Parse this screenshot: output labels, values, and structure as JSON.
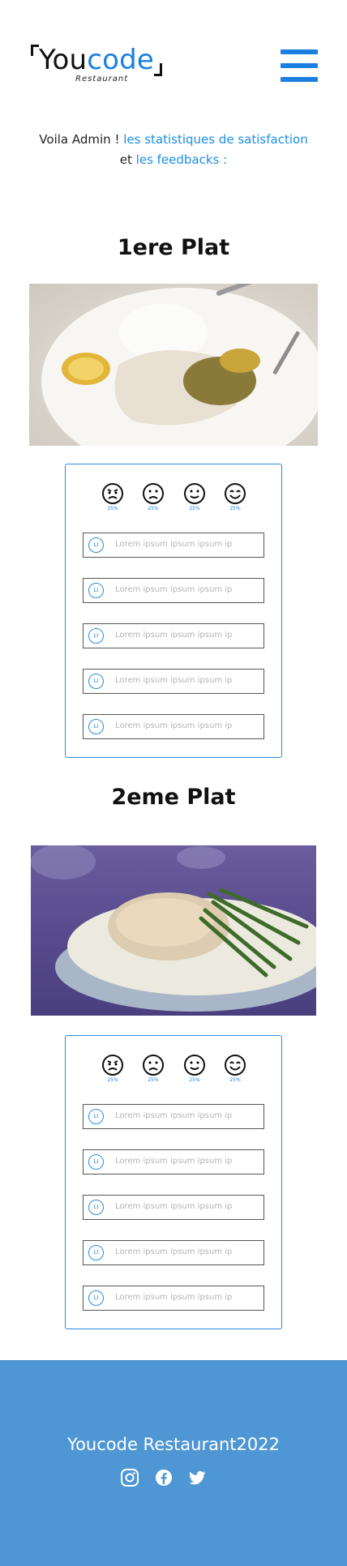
{
  "header": {
    "logo_you": "You",
    "logo_code": "code",
    "logo_sub": "Restaurant"
  },
  "intro": {
    "prefix": "Voila Admin ! ",
    "link1": "les statistiques de satisfaction",
    "middle": "et ",
    "link2": "les feedbacks :"
  },
  "dishes": [
    {
      "title": "1ere Plat",
      "ratings": [
        "25%",
        "25%",
        "25%",
        "25%"
      ],
      "feedbacks": [
        {
          "avatar": "LI",
          "text": "Lorem ipsum ipsum ipsum ip"
        },
        {
          "avatar": "LI",
          "text": "Lorem ipsum ipsum ipsum ip"
        },
        {
          "avatar": "LI",
          "text": "Lorem ipsum ipsum ipsum ip"
        },
        {
          "avatar": "LI",
          "text": "Lorem ipsum ipsum ipsum ip"
        },
        {
          "avatar": "LI",
          "text": "Lorem ipsum ipsum ipsum ip"
        }
      ]
    },
    {
      "title": "2eme Plat",
      "ratings": [
        "25%",
        "25%",
        "25%",
        "25%"
      ],
      "feedbacks": [
        {
          "avatar": "LI",
          "text": "Lorem ipsum ipsum ipsum ip"
        },
        {
          "avatar": "LI",
          "text": "Lorem ipsum ipsum ipsum ip"
        },
        {
          "avatar": "LI",
          "text": "Lorem ipsum ipsum ipsum ip"
        },
        {
          "avatar": "LI",
          "text": "Lorem ipsum ipsum ipsum ip"
        },
        {
          "avatar": "LI",
          "text": "Lorem ipsum ipsum ipsum ip"
        }
      ]
    }
  ],
  "footer": {
    "brand": "Youcode Restaurant2022",
    "icons": [
      "instagram-icon",
      "facebook-icon",
      "twitter-icon"
    ]
  },
  "colors": {
    "accent": "#1a7fe0",
    "footer_bg": "#4f97d4"
  }
}
